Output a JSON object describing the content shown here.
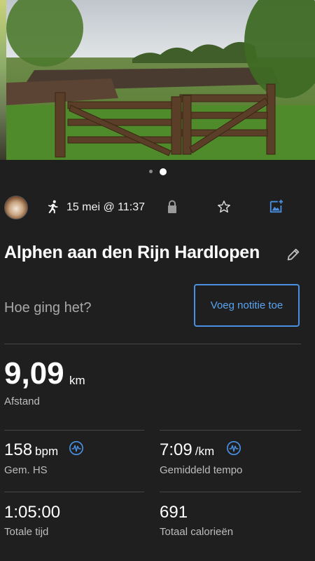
{
  "colors": {
    "background": "#1f1f1f",
    "accent": "#4a90e2",
    "text": "#ffffff",
    "muted": "#a8a8a8"
  },
  "gallery": {
    "active_index": 1,
    "count": 2
  },
  "activity": {
    "date": "15 mei @ 11:37",
    "title": "Alphen aan den Rijn Hardlopen",
    "type_icon": "running-icon"
  },
  "note": {
    "question": "Hoe ging het?",
    "button_label": "Voeg notitie toe"
  },
  "distance": {
    "value": "9,09",
    "unit": "km",
    "label": "Afstand"
  },
  "stats": {
    "heart_rate": {
      "value": "158",
      "unit": "bpm",
      "label": "Gem. HS"
    },
    "pace": {
      "value": "7:09",
      "unit": "/km",
      "label": "Gemiddeld tempo"
    },
    "time": {
      "value": "1:05:00",
      "label": "Totale tijd"
    },
    "calories": {
      "value": "691",
      "label": "Totaal calorieën"
    }
  }
}
